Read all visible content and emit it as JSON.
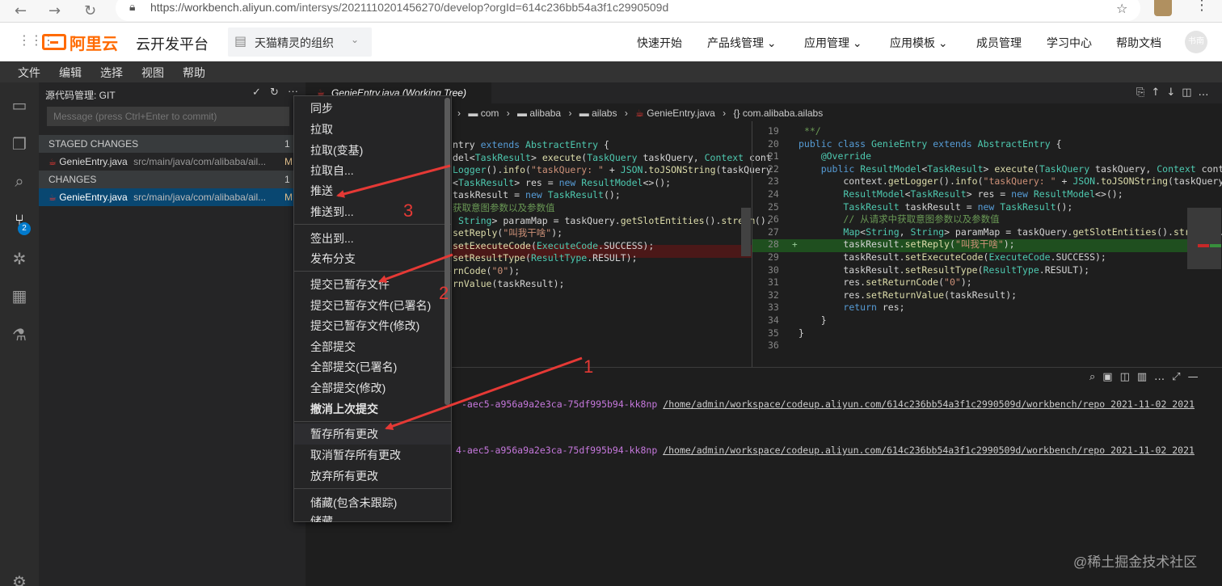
{
  "browser": {
    "url_host": "https://workbench.aliyun.com",
    "url_path": "/intersys/2021110201456270/develop?orgId=614c236bb54a3f1c2990509d",
    "back_icon": "arrow-left-icon",
    "forward_icon": "arrow-right-icon",
    "reload_icon": "reload-icon"
  },
  "app_header": {
    "logo_text": "阿里云",
    "product_name": "云开发平台",
    "org_name": "天猫精灵的组织",
    "nav": [
      "快速开始",
      "产品线管理",
      "应用管理",
      "应用模板",
      "成员管理",
      "学习中心",
      "帮助文档"
    ],
    "avatar_text": "书南"
  },
  "menubar": [
    "文件",
    "编辑",
    "选择",
    "视图",
    "帮助"
  ],
  "scm": {
    "title": "源代码管理: GIT",
    "message_placeholder": "Message (press Ctrl+Enter to commit)",
    "staged_header": "STAGED CHANGES",
    "staged_count": "1",
    "staged_file": "GenieEntry.java",
    "staged_path": "src/main/java/com/alibaba/ail...",
    "staged_status": "M",
    "changes_header": "CHANGES",
    "changes_count": "1",
    "changes_file": "GenieEntry.java",
    "changes_path": "src/main/java/com/alibaba/ail...",
    "changes_status": "M"
  },
  "editor": {
    "tab_title": "GenieEntry.java (Working Tree)",
    "breadcrumb": [
      "com",
      "alibaba",
      "ailabs",
      "GenieEntry.java",
      "{} com.alibaba.ailabs"
    ],
    "left_lines": [
      "ntry extends AbstractEntry {",
      "",
      "del<TaskResult> execute(TaskQuery taskQuery, Context cont",
      "Logger().info(\"taskQuery: \" + JSON.toJSONString(taskQuery",
      "<TaskResult> res = new ResultModel<>();",
      "taskResult = new TaskResult();",
      "获取意图参数以及参数值",
      " String> paramMap = taskQuery.getSlotEntities().stream().",
      "setReply(\"叫我干啥\");",
      "setExecuteCode(ExecuteCode.SUCCESS);",
      "setResultType(ResultType.RESULT);",
      "rnCode(\"0\");",
      "rnValue(taskResult);"
    ],
    "right_numbers": [
      "19",
      "20",
      "21",
      "22",
      "23",
      "24",
      "25",
      "26",
      "27",
      "28",
      "29",
      "30",
      "31",
      "32",
      "33",
      "34",
      "35",
      "36"
    ],
    "right_lines": [
      " **/",
      "public class GenieEntry extends AbstractEntry {",
      "    @Override",
      "    public ResultModel<TaskResult> execute(TaskQuery taskQuery, Context conte",
      "        context.getLogger().info(\"taskQuery: \" + JSON.toJSONString(taskQuery",
      "        ResultModel<TaskResult> res = new ResultModel<>();",
      "        TaskResult taskResult = new TaskResult();",
      "        // 从请求中获取意图参数以及参数值",
      "        Map<String, String> paramMap = taskQuery.getSlotEntities().stream().",
      "        taskResult.setReply(\"叫我干啥\");",
      "        taskResult.setExecuteCode(ExecuteCode.SUCCESS);",
      "        taskResult.setResultType(ResultType.RESULT);",
      "        res.setReturnCode(\"0\");",
      "        res.setReturnValue(taskResult);",
      "        return res;",
      "    }",
      "}",
      ""
    ]
  },
  "terminal": {
    "line1_id": "-aec5-a956a9a2e3ca-75df995b94-kk8np",
    "line1_path": "/home/admin/workspace/codeup.aliyun.com/614c236bb54a3f1c2990509d/workbench/repo 2021-11-02 2021",
    "line2_id": "4-aec5-a956a9a2e3ca-75df995b94-kk8np",
    "line2_path": "/home/admin/workspace/codeup.aliyun.com/614c236bb54a3f1c2990509d/workbench/repo 2021-11-02 2021"
  },
  "context_menu": [
    "同步",
    "拉取",
    "拉取(变基)",
    "拉取自...",
    "推送",
    "推送到...",
    "签出到...",
    "发布分支",
    "提交已暂存文件",
    "提交已暂存文件(已署名)",
    "提交已暂存文件(修改)",
    "全部提交",
    "全部提交(已署名)",
    "全部提交(修改)",
    "撤消上次提交",
    "暂存所有更改",
    "取消暂存所有更改",
    "放弃所有更改",
    "储藏(包含未跟踪)",
    "储藏"
  ],
  "annotations": [
    "1",
    "2",
    "3"
  ],
  "watermark": "@稀土掘金技术社区",
  "colors": {
    "accent_red": "#e53935",
    "logo_orange": "#ff6a00",
    "badge_blue": "#007acc"
  }
}
